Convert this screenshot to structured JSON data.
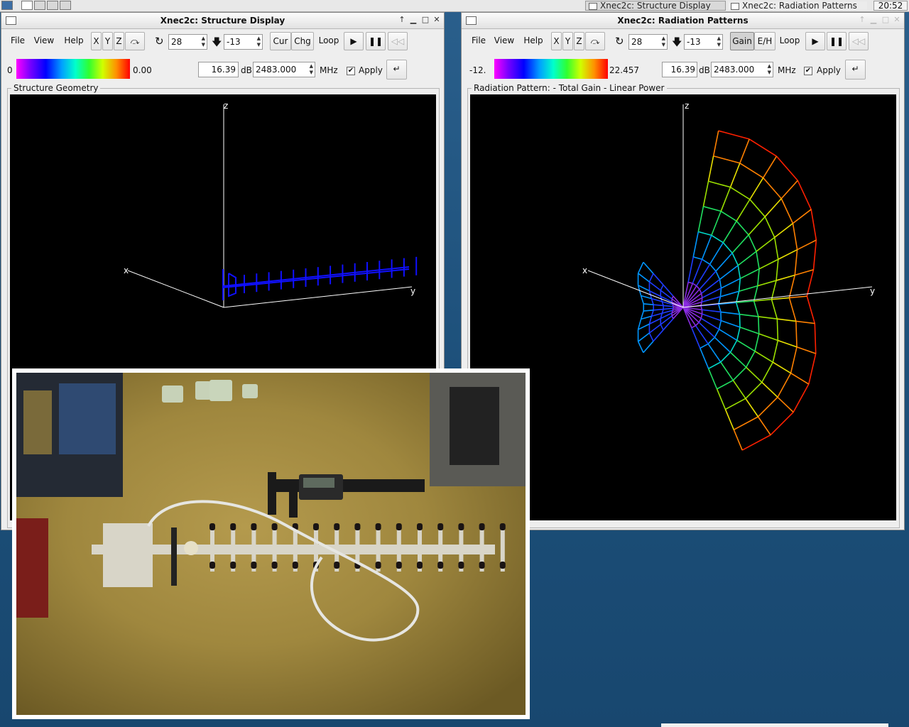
{
  "taskbar": {
    "tasks": [
      {
        "label": "Xnec2c: Structure Display"
      },
      {
        "label": "Xnec2c: Radiation Patterns"
      }
    ],
    "clock": "20:52"
  },
  "structure_window": {
    "title": "Xnec2c: Structure Display",
    "menu": {
      "file": "File",
      "view": "View",
      "help": "Help"
    },
    "axis_buttons": {
      "x": "X",
      "y": "Y",
      "z": "Z"
    },
    "rotate_value": "28",
    "tilt_value": "-13",
    "cur_label": "Cur",
    "chg_label": "Chg",
    "loop_label": "Loop",
    "scale_min": "0",
    "scale_max": "0.00",
    "gain_value": "16.39",
    "db_label": "dB",
    "freq_value": "2483.000",
    "mhz_label": "MHz",
    "apply_label": "Apply",
    "frame_title": "Structure Geometry",
    "axes": {
      "x": "x",
      "y": "y",
      "z": "z"
    }
  },
  "pattern_window": {
    "title": "Xnec2c: Radiation Patterns",
    "menu": {
      "file": "File",
      "view": "View",
      "help": "Help"
    },
    "axis_buttons": {
      "x": "X",
      "y": "Y",
      "z": "Z"
    },
    "rotate_value": "28",
    "tilt_value": "-13",
    "gain_label": "Gain",
    "eh_label": "E/H",
    "loop_label": "Loop",
    "scale_min": "-12.",
    "scale_max": "22.457",
    "gain_value": "16.39",
    "db_label": "dB",
    "freq_value": "2483.000",
    "mhz_label": "MHz",
    "apply_label": "Apply",
    "frame_title": "Radiation Pattern: - Total Gain - Linear Power",
    "axes": {
      "x": "x",
      "y": "y",
      "z": "z"
    }
  },
  "colors": {
    "desktop": "#1f527d",
    "structure_wire": "#1010ff",
    "canvas_bg": "#000000"
  }
}
